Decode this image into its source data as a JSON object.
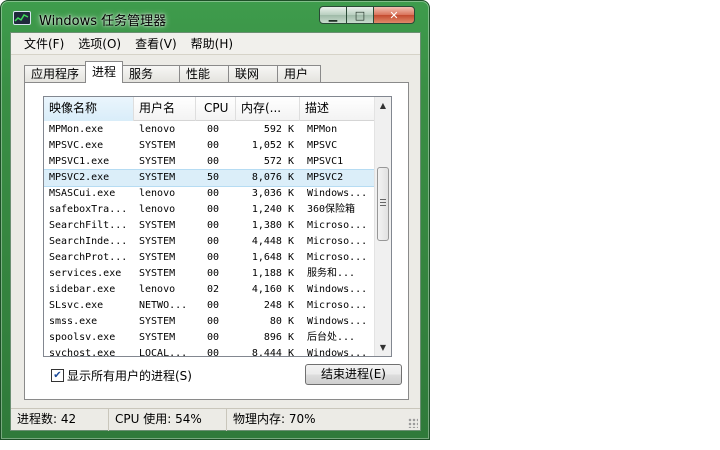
{
  "window": {
    "title": "Windows 任务管理器",
    "minimize_glyph": "▁",
    "maximize_glyph": "□",
    "close_glyph": "✕"
  },
  "menu": [
    "文件(F)",
    "选项(O)",
    "查看(V)",
    "帮助(H)"
  ],
  "tabs": [
    {
      "label": "应用程序",
      "active": false
    },
    {
      "label": "进程",
      "active": true
    },
    {
      "label": "服务",
      "active": false
    },
    {
      "label": "性能",
      "active": false
    },
    {
      "label": "联网",
      "active": false
    },
    {
      "label": "用户",
      "active": false
    }
  ],
  "columns": {
    "name": "映像名称",
    "user": "用户名",
    "cpu": "CPU",
    "mem": "内存(...",
    "desc": "描述"
  },
  "processes": [
    {
      "name": "MPMon.exe",
      "user": "lenovo",
      "cpu": "00",
      "mem": "592 K",
      "desc": "MPMon"
    },
    {
      "name": "MPSVC.exe",
      "user": "SYSTEM",
      "cpu": "00",
      "mem": "1,052 K",
      "desc": "MPSVC"
    },
    {
      "name": "MPSVC1.exe",
      "user": "SYSTEM",
      "cpu": "00",
      "mem": "572 K",
      "desc": "MPSVC1"
    },
    {
      "name": "MPSVC2.exe",
      "user": "SYSTEM",
      "cpu": "50",
      "mem": "8,076 K",
      "desc": "MPSVC2"
    },
    {
      "name": "MSASCui.exe",
      "user": "lenovo",
      "cpu": "00",
      "mem": "3,036 K",
      "desc": "Windows..."
    },
    {
      "name": "safeboxTra...",
      "user": "lenovo",
      "cpu": "00",
      "mem": "1,240 K",
      "desc": "360保险箱"
    },
    {
      "name": "SearchFilt...",
      "user": "SYSTEM",
      "cpu": "00",
      "mem": "1,380 K",
      "desc": "Microso..."
    },
    {
      "name": "SearchInde...",
      "user": "SYSTEM",
      "cpu": "00",
      "mem": "4,448 K",
      "desc": "Microso..."
    },
    {
      "name": "SearchProt...",
      "user": "SYSTEM",
      "cpu": "00",
      "mem": "1,648 K",
      "desc": "Microso..."
    },
    {
      "name": "services.exe",
      "user": "SYSTEM",
      "cpu": "00",
      "mem": "1,188 K",
      "desc": "服务和..."
    },
    {
      "name": "sidebar.exe",
      "user": "lenovo",
      "cpu": "02",
      "mem": "4,160 K",
      "desc": "Windows..."
    },
    {
      "name": "SLsvc.exe",
      "user": "NETWO...",
      "cpu": "00",
      "mem": "248 K",
      "desc": "Microso..."
    },
    {
      "name": "smss.exe",
      "user": "SYSTEM",
      "cpu": "00",
      "mem": "80 K",
      "desc": "Windows..."
    },
    {
      "name": "spoolsv.exe",
      "user": "SYSTEM",
      "cpu": "00",
      "mem": "896 K",
      "desc": "后台处..."
    },
    {
      "name": "svchost.exe",
      "user": "LOCAL...",
      "cpu": "00",
      "mem": "8,444 K",
      "desc": "Windows..."
    }
  ],
  "selected_process": "MPSVC2.exe",
  "show_all_users": {
    "label": "显示所有用户的进程(S)",
    "checked": true
  },
  "end_process_button": "结束进程(E)",
  "status": {
    "processes": "进程数: 42",
    "cpu": "CPU 使用: 54%",
    "memory": "物理内存: 70%"
  },
  "icons": {
    "scroll_up": "▲",
    "scroll_down": "▼",
    "check": "✔"
  }
}
